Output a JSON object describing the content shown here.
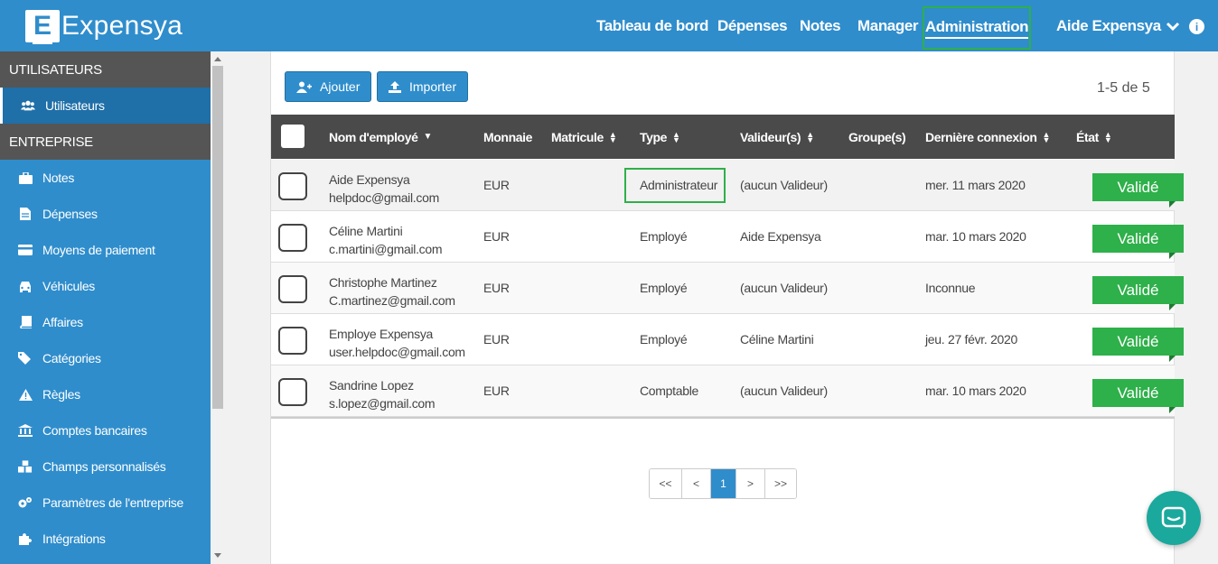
{
  "app": {
    "logo_letter": "E",
    "name": "Expensya"
  },
  "nav": {
    "dashboard": "Tableau de bord",
    "expenses": "Dépenses",
    "notes": "Notes",
    "manager": "Manager",
    "administration": "Administration",
    "user": "Aide Expensya"
  },
  "sidebar": {
    "section_users": "UTILISATEURS",
    "section_company": "ENTREPRISE",
    "users_item": "Utilisateurs",
    "items": [
      {
        "label": "Notes",
        "icon": "briefcase-icon"
      },
      {
        "label": "Dépenses",
        "icon": "file-icon"
      },
      {
        "label": "Moyens de paiement",
        "icon": "credit-card-icon"
      },
      {
        "label": "Véhicules",
        "icon": "car-icon"
      },
      {
        "label": "Affaires",
        "icon": "book-icon"
      },
      {
        "label": "Catégories",
        "icon": "tags-icon"
      },
      {
        "label": "Règles",
        "icon": "warning-icon"
      },
      {
        "label": "Comptes bancaires",
        "icon": "bank-icon"
      },
      {
        "label": "Champs personnalisés",
        "icon": "cubes-icon"
      },
      {
        "label": "Paramètres de l'entreprise",
        "icon": "cogs-icon"
      },
      {
        "label": "Intégrations",
        "icon": "puzzle-icon"
      }
    ]
  },
  "toolbar": {
    "add_label": "Ajouter",
    "import_label": "Importer",
    "count": "1-5 de 5"
  },
  "table": {
    "headers": {
      "name": "Nom d'employé",
      "currency": "Monnaie",
      "matricule": "Matricule",
      "type": "Type",
      "validators": "Valideur(s)",
      "groups": "Groupe(s)",
      "last_login": "Dernière connexion",
      "state": "État"
    },
    "rows": [
      {
        "name": "Aide Expensya",
        "email": "helpdoc@gmail.com",
        "currency": "EUR",
        "type": "Administrateur",
        "validator": "(aucun Valideur)",
        "last_login": "mer. 11 mars 2020",
        "state": "Validé"
      },
      {
        "name": "Céline Martini",
        "email": "c.martini@gmail.com",
        "currency": "EUR",
        "type": "Employé",
        "validator": "Aide Expensya",
        "last_login": "mar. 10 mars 2020",
        "state": "Validé"
      },
      {
        "name": "Christophe Martinez",
        "email": "C.martinez@gmail.com",
        "currency": "EUR",
        "type": "Employé",
        "validator": "(aucun Valideur)",
        "last_login": "Inconnue",
        "state": "Validé"
      },
      {
        "name": "Employe Expensya",
        "email": "user.helpdoc@gmail.com",
        "currency": "EUR",
        "type": "Employé",
        "validator": "Céline Martini",
        "last_login": "jeu. 27 févr. 2020",
        "state": "Validé"
      },
      {
        "name": "Sandrine Lopez",
        "email": "s.lopez@gmail.com",
        "currency": "EUR",
        "type": "Comptable",
        "validator": "(aucun Valideur)",
        "last_login": "mar. 10 mars 2020",
        "state": "Validé"
      }
    ]
  },
  "pagination": {
    "first": "<<",
    "prev": "<",
    "current": "1",
    "next": ">",
    "last": ">>"
  },
  "colors": {
    "primary": "#2f8dcc",
    "success": "#2eb04a",
    "header_dark": "#4a4a4a",
    "chat": "#1aa99c"
  }
}
